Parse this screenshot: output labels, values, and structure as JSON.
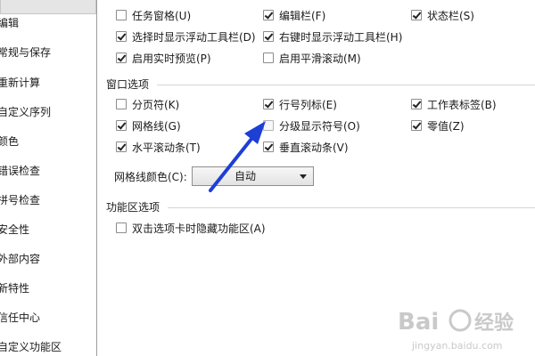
{
  "sidebar": {
    "items": [
      {
        "label": "编辑"
      },
      {
        "label": "常规与保存"
      },
      {
        "label": "重新计算"
      },
      {
        "label": "自定义序列"
      },
      {
        "label": "颜色"
      },
      {
        "label": "错误检查"
      },
      {
        "label": "拼号检查"
      },
      {
        "label": "安全性"
      },
      {
        "label": "外部内容"
      },
      {
        "label": "新特性"
      },
      {
        "label": "信任中心"
      },
      {
        "label": "自定义功能区"
      }
    ]
  },
  "show": {
    "task_pane": {
      "label": "任务窗格(U)",
      "checked": false
    },
    "edit_bar": {
      "label": "编辑栏(F)",
      "checked": true
    },
    "status_bar": {
      "label": "状态栏(S)",
      "checked": true
    },
    "float_toolbar_select": {
      "label": "选择时显示浮动工具栏(D)",
      "checked": true
    },
    "float_toolbar_rightclick": {
      "label": "右键时显示浮动工具栏(H)",
      "checked": true
    },
    "live_preview": {
      "label": "启用实时预览(P)",
      "checked": true
    },
    "smooth_scroll": {
      "label": "启用平滑滚动(M)",
      "checked": false
    }
  },
  "window_options": {
    "title": "窗口选项",
    "page_break": {
      "label": "分页符(K)",
      "checked": false
    },
    "row_col_headers": {
      "label": "行号列标(E)",
      "checked": true
    },
    "sheet_tabs": {
      "label": "工作表标签(B)",
      "checked": true
    },
    "gridlines": {
      "label": "网格线(G)",
      "checked": true
    },
    "outline_symbols": {
      "label": "分级显示符号(O)",
      "checked": false
    },
    "zero_values": {
      "label": "零值(Z)",
      "checked": true
    },
    "h_scroll": {
      "label": "水平滚动条(T)",
      "checked": true
    },
    "v_scroll": {
      "label": "垂直滚动条(V)",
      "checked": true
    },
    "grid_color_label": "网格线颜色(C):",
    "grid_color_value": "自动"
  },
  "ribbon_options": {
    "title": "功能区选项",
    "hide_on_double_click": {
      "label": "双击选项卡时隐藏功能区(A)",
      "checked": false
    }
  },
  "watermark": {
    "brand": "Bai",
    "brand_cn": "经验",
    "url": "jingyan.baidu.com"
  },
  "colors": {
    "arrow": "#1d3fd6",
    "watermark": "#c9c9c9"
  }
}
